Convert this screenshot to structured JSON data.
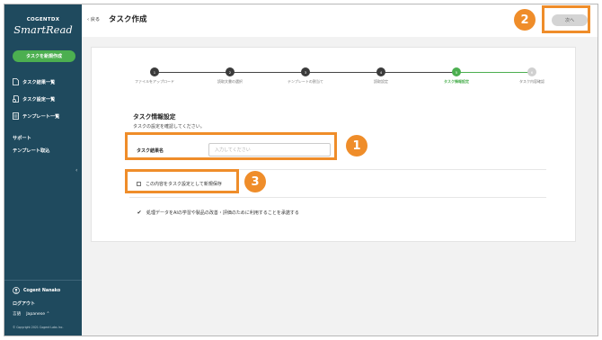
{
  "sidebar": {
    "brand_top": "COGENTDX",
    "brand_main": "SmartRead",
    "new_task_button": "タスクを新規作成",
    "nav": [
      {
        "label": "タスク結果一覧",
        "icon": "document-icon"
      },
      {
        "label": "タスク設定一覧",
        "icon": "settings-doc-icon"
      },
      {
        "label": "テンプレート一覧",
        "icon": "template-icon"
      }
    ],
    "support": "サポート",
    "template_import": "テンプレート取込",
    "collapse_icon": "‹",
    "user_name": "Cogent Nanako",
    "logout": "ログアウト",
    "language_label": "言語",
    "language_value": "Japanese ⌃",
    "copyright": "© Copyright 2021 Cogent Labs Inc."
  },
  "header": {
    "back": "‹ 戻る",
    "title": "タスク作成",
    "next_button": "次へ"
  },
  "stepper": {
    "steps": [
      {
        "num": "1",
        "label": "ファイルをアップロード",
        "state": "done"
      },
      {
        "num": "2",
        "label": "読取文書の選択",
        "state": "done"
      },
      {
        "num": "3",
        "label": "テンプレートの割当て",
        "state": "done"
      },
      {
        "num": "4",
        "label": "読取設定",
        "state": "done"
      },
      {
        "num": "5",
        "label": "タスク情報設定",
        "state": "active"
      },
      {
        "num": "6",
        "label": "タスク内容確認",
        "state": "pending"
      }
    ]
  },
  "form": {
    "section_title": "タスク情報設定",
    "section_desc": "タスクの設定を確認してください。",
    "task_name_label": "タスク結果名",
    "task_name_placeholder": "入力してください",
    "save_as_new_label": "この内容をタスク設定として新規保存",
    "consent_label": "処理データをAIの学習や製品の改善・評価のために利用することを承諾する",
    "consent_check": "✔"
  },
  "annotations": {
    "badge1": "1",
    "badge2": "2",
    "badge3": "3",
    "color": "#ef8d2a"
  }
}
